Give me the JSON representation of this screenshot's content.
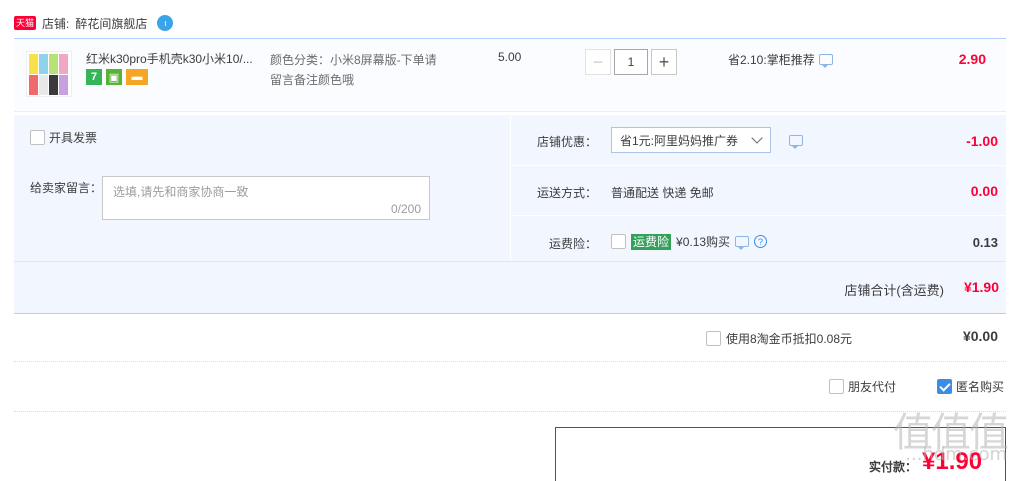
{
  "store": {
    "badge": "天猫",
    "prefix": "店铺:",
    "name": "醉花间旗舰店"
  },
  "item": {
    "title": "红米k30pro手机壳k30小米10/...",
    "sku_line1": "颜色分类：小米8屏幕版-下单请",
    "sku_line2": "留言备注颜色哦",
    "unit_price": "5.00",
    "quantity": "1",
    "qty_minus": "−",
    "qty_plus": "+",
    "promo": "省2.10:掌柜推荐",
    "total": "2.90",
    "service_icons": [
      "7",
      "tmall-icon",
      "card-icon"
    ]
  },
  "options": {
    "invoice_label": "开具发票",
    "message_label": "给卖家留言：",
    "message_placeholder": "选填,请先和商家协商一致",
    "message_count": "0/200",
    "coupon_label": "店铺优惠：",
    "coupon_value": "省1元:阿里妈妈推广券",
    "coupon_amount": "-1.00",
    "shipping_label": "运送方式：",
    "shipping_value": "普通配送 快递 免邮",
    "shipping_amount": "0.00",
    "insurance_label": "运费险：",
    "insurance_tag": "运费险",
    "insurance_value": "¥0.13购买",
    "insurance_amount": "0.13",
    "store_total_label": "店铺合计(含运费)",
    "store_total_amount": "¥1.90"
  },
  "coins": {
    "label": "使用8淘金币抵扣0.08元",
    "amount": "¥0.00"
  },
  "purchase": {
    "friend_pay_label": "朋友代付",
    "anonymous_label": "匿名购买",
    "anonymous_checked": true
  },
  "payment": {
    "label": "实付款：",
    "amount": "¥1.90"
  },
  "watermark": {
    "text": "值值值",
    "url": "...hdm.com"
  },
  "colors": {
    "accent_red": "#ff0036",
    "panel_blue": "#f2f7ff",
    "border_blue": "#b2d1ff",
    "checkbox_blue": "#3a8ee6"
  }
}
